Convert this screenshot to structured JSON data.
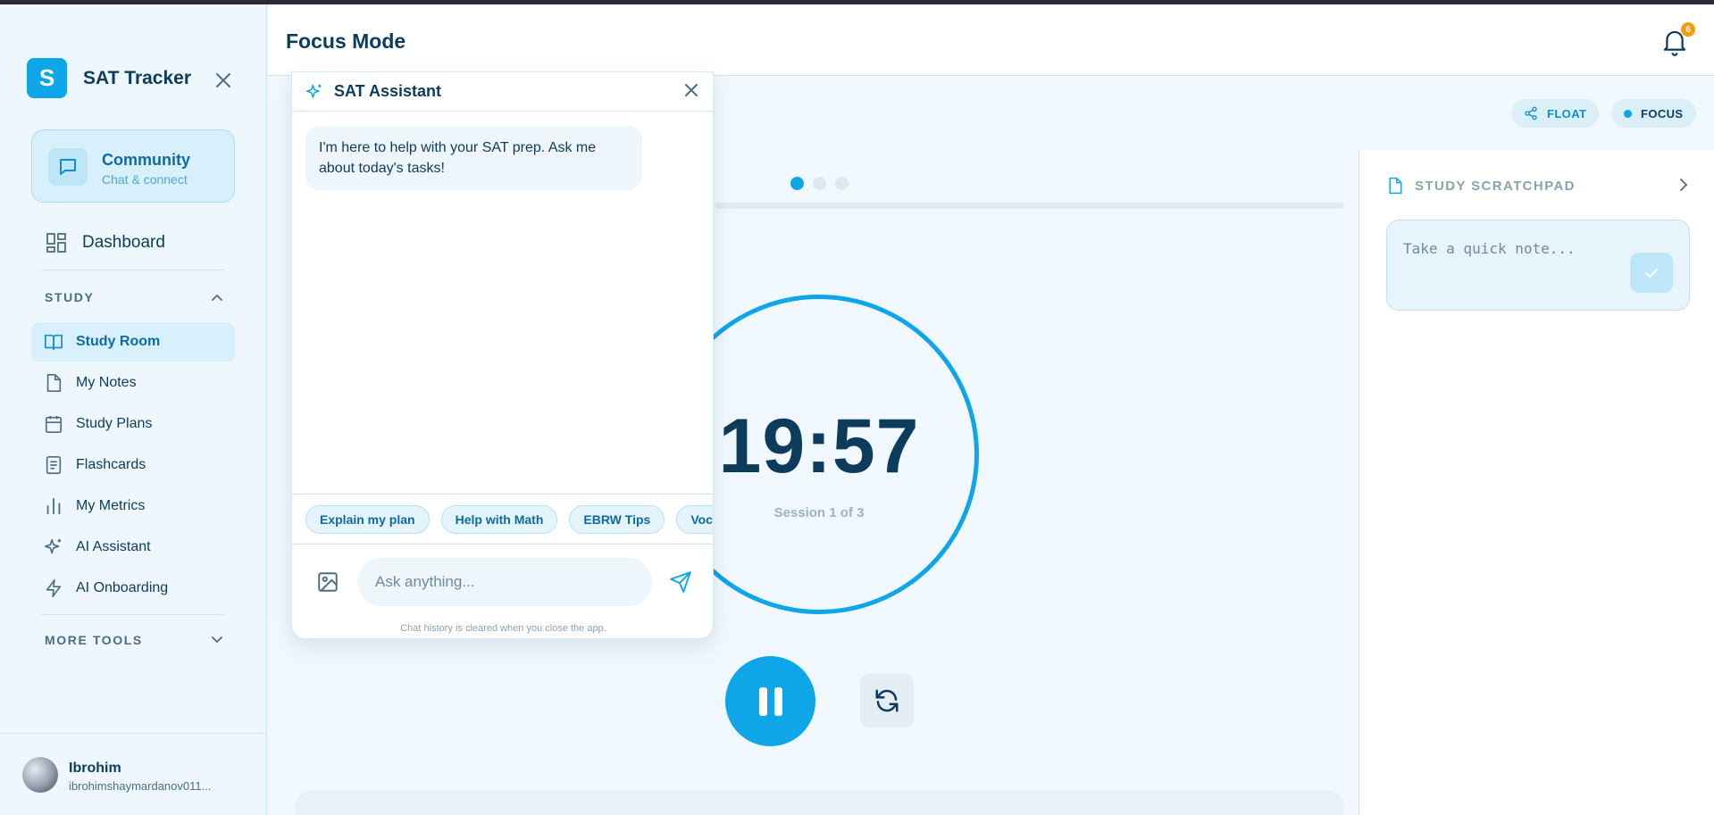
{
  "app": {
    "logo_letter": "S",
    "name": "SAT Tracker"
  },
  "sidebar": {
    "community": {
      "title": "Community",
      "subtitle": "Chat & connect"
    },
    "dashboard_label": "Dashboard",
    "study_section": "STUDY",
    "items": [
      {
        "label": "Study Room",
        "icon": "book-open-icon",
        "active": true
      },
      {
        "label": "My Notes",
        "icon": "file-icon"
      },
      {
        "label": "Study Plans",
        "icon": "calendar-icon"
      },
      {
        "label": "Flashcards",
        "icon": "notebook-icon"
      },
      {
        "label": "My Metrics",
        "icon": "bar-chart-icon"
      },
      {
        "label": "AI Assistant",
        "icon": "sparkles-icon"
      },
      {
        "label": "AI Onboarding",
        "icon": "zap-icon"
      }
    ],
    "more_tools_section": "MORE TOOLS"
  },
  "user": {
    "name": "Ibrohim",
    "email": "ibrohimshaymardanov011..."
  },
  "header": {
    "title": "Focus Mode",
    "notification_count": "6"
  },
  "main": {
    "float_label": "FLOAT",
    "focus_label": "FOCUS",
    "timer": "19:57",
    "session": "Session 1 of 3",
    "session_steps": {
      "current": 1,
      "total": 3
    }
  },
  "scratchpad": {
    "title": "STUDY SCRATCHPAD",
    "placeholder": "Take a quick note..."
  },
  "chat": {
    "title": "SAT Assistant",
    "message": "I'm here to help with your SAT prep. Ask me about today's tasks!",
    "chips": [
      "Explain my plan",
      "Help with Math",
      "EBRW Tips",
      "Vocabulary"
    ],
    "input_placeholder": "Ask anything...",
    "footer_note": "Chat history is cleared when you close the app."
  },
  "colors": {
    "accent": "#0ea5e9",
    "text_dark": "#0d3b5c",
    "badge": "#f59e0b"
  }
}
